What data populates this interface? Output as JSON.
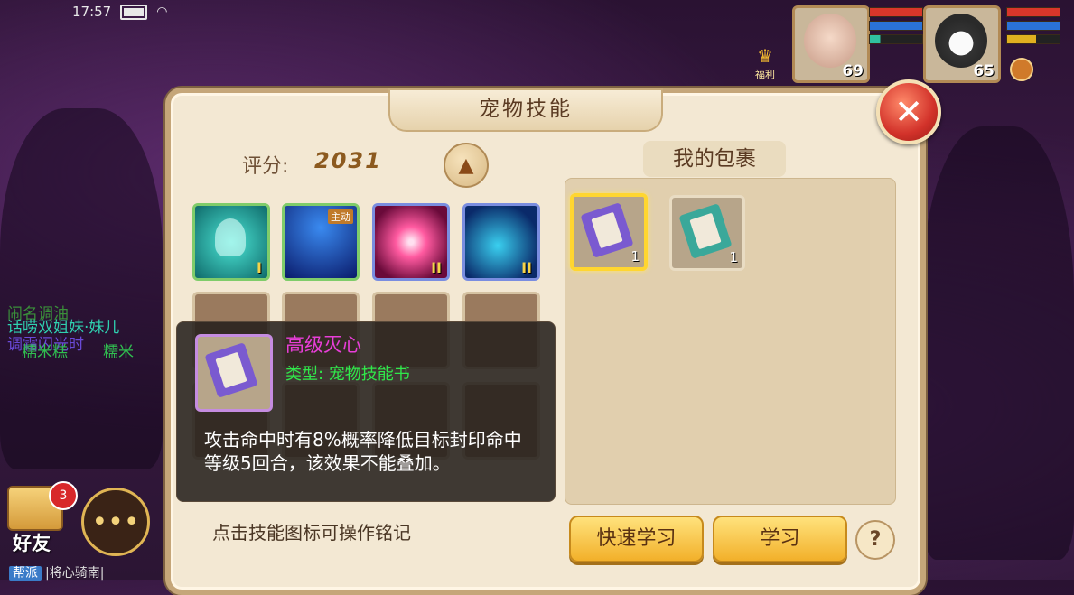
{
  "status_bar": {
    "time": "17:57"
  },
  "party": [
    {
      "level": "69"
    },
    {
      "level": "65"
    }
  ],
  "fuli_label": "福利",
  "chat_lines": [
    {
      "text": "闹名调油",
      "color": "#3a8f3a"
    },
    {
      "text": "话唠双姐妹·妹儿",
      "color": "#2fd1b0"
    },
    {
      "text": "调霜闪光时",
      "color": "#6a4ad8"
    },
    {
      "text": "糯米糕",
      "color": "#30c050"
    },
    {
      "text": "糯米",
      "color": "#30c050"
    }
  ],
  "friends": {
    "label": "好友",
    "badge": "3"
  },
  "bottom_chat": {
    "tag": "帮派",
    "text": "|将心骑南|"
  },
  "panel": {
    "title": "宠物技能",
    "score_label": "评分:",
    "score_value": "2031",
    "bag_title": "我的包裹",
    "hint": "点击技能图标可操作铭记",
    "quick_learn": "快速学习",
    "learn": "学习",
    "help": "?"
  },
  "skills": [
    {
      "name": "ghost-skill",
      "rank": "I",
      "tag": "",
      "colors": [
        "#0f6a6a",
        "#4ce6d6"
      ]
    },
    {
      "name": "slash-skill",
      "rank": "",
      "tag": "主动",
      "colors": [
        "#0a1a6a",
        "#3a8af0"
      ]
    },
    {
      "name": "burst-skill",
      "rank": "II",
      "tag": "",
      "colors": [
        "#6a0a3a",
        "#ff5aa0"
      ]
    },
    {
      "name": "vortex-skill",
      "rank": "II",
      "tag": "",
      "colors": [
        "#0a2a6a",
        "#3ad0f0"
      ]
    }
  ],
  "bag_items": [
    {
      "count": "1",
      "selected": true,
      "cover": "#7a5ad0"
    },
    {
      "count": "1",
      "selected": false,
      "cover": "#3aa89a"
    }
  ],
  "tooltip": {
    "name": "高级灭心",
    "type": "类型: 宠物技能书",
    "desc": "攻击命中时有8%概率降低目标封印命中等级5回合，该效果不能叠加。"
  }
}
